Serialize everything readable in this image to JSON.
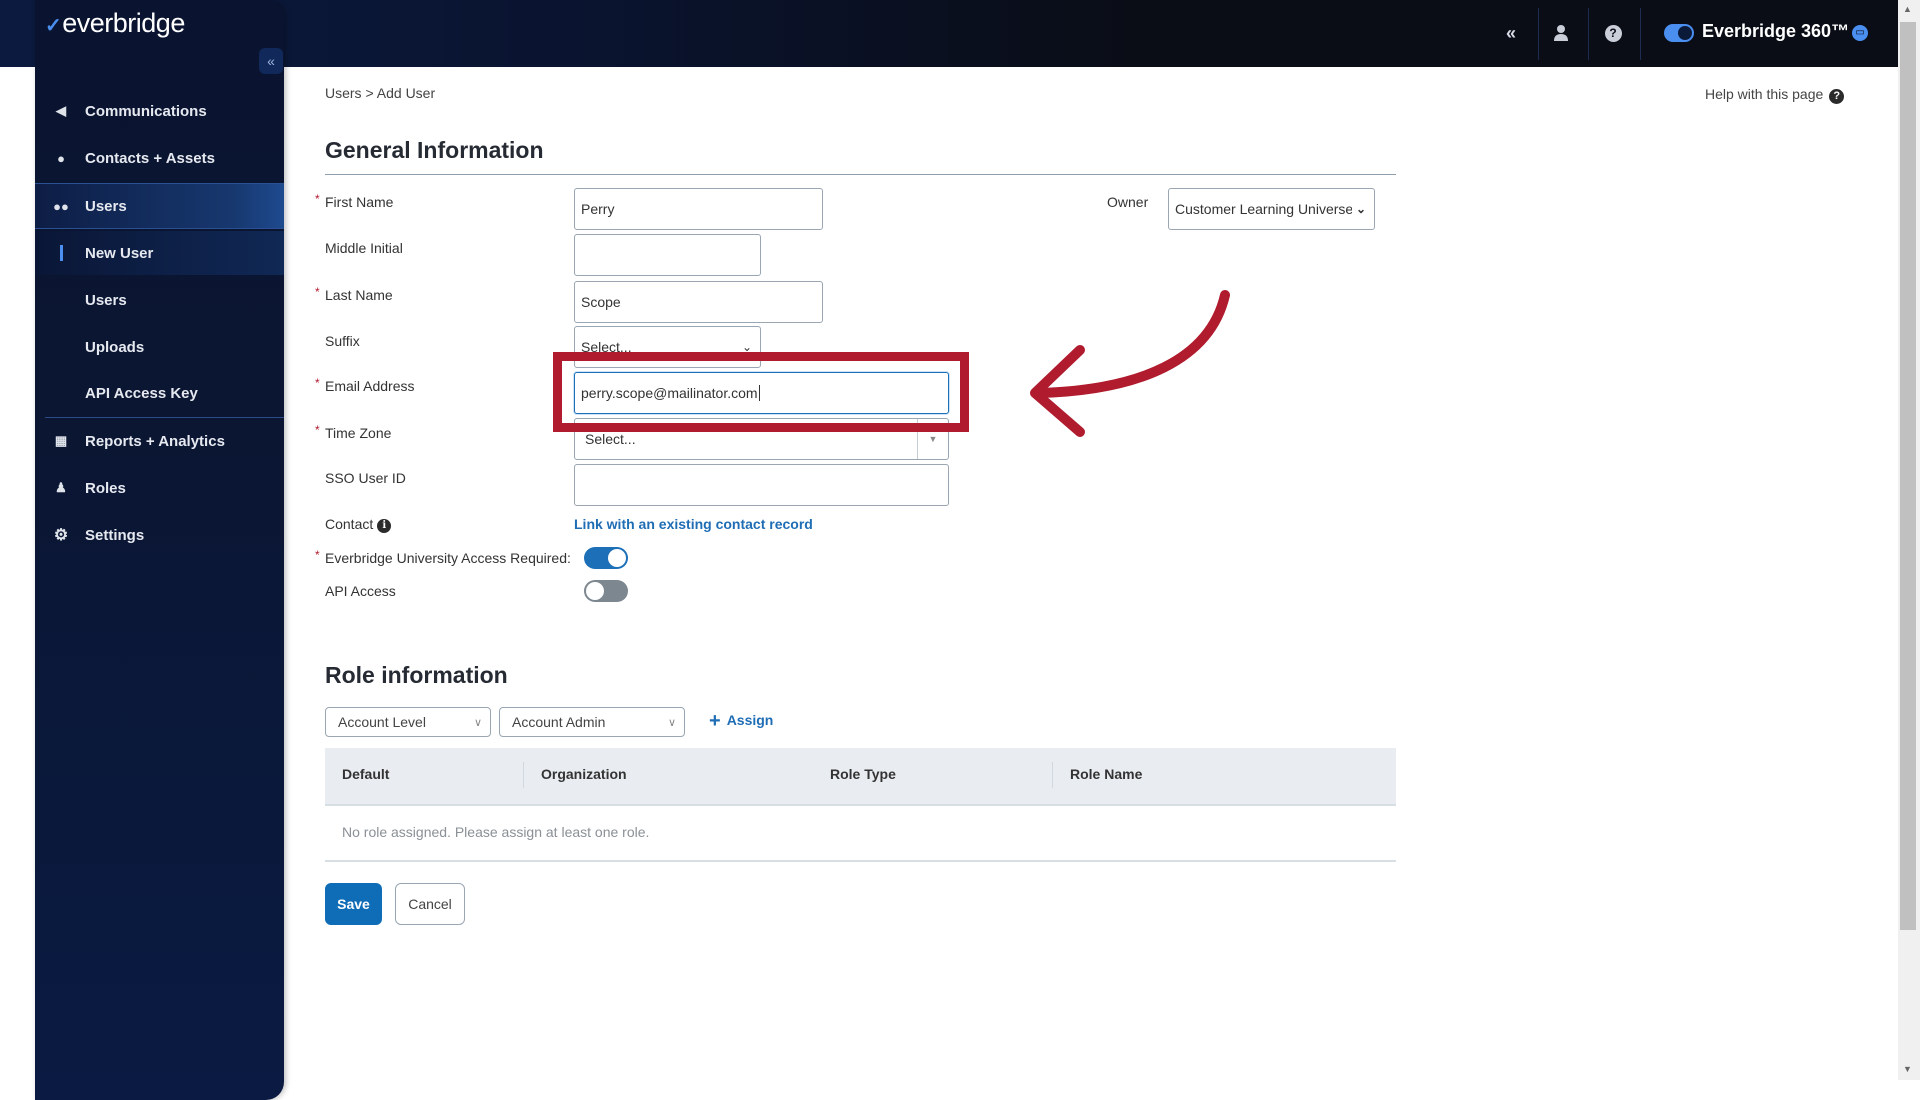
{
  "header": {
    "collapse_icon": "double-chevron-left-icon",
    "collapse_glyph": "«",
    "profile_icon": "user-icon",
    "help_icon": "question-circle-icon",
    "product_label": "Everbridge 360™",
    "product_toggle_on": true,
    "chat_icon": "chat-bubble-icon"
  },
  "sidebar": {
    "logo_text": "everbridge",
    "collapse_glyph": "«",
    "items": [
      {
        "label": "Communications",
        "icon": "megaphone-icon",
        "glyph": "📢"
      },
      {
        "label": "Contacts + Assets",
        "icon": "map-pin-icon",
        "glyph": "⚲"
      },
      {
        "label": "Users",
        "icon": "users-icon",
        "glyph": "👥"
      },
      {
        "label": "Reports + Analytics",
        "icon": "bar-chart-icon",
        "glyph": "▦"
      },
      {
        "label": "Roles",
        "icon": "user-gear-icon",
        "glyph": "👤"
      },
      {
        "label": "Settings",
        "icon": "gear-icon",
        "glyph": "⚙"
      }
    ],
    "users_subitems": [
      {
        "label": "New User",
        "current": true
      },
      {
        "label": "Users"
      },
      {
        "label": "Uploads"
      },
      {
        "label": "API Access Key"
      }
    ]
  },
  "breadcrumb": {
    "parent": "Users",
    "separator": ">",
    "current": "Add User"
  },
  "help": {
    "label": "Help with this page"
  },
  "general": {
    "title": "General Information",
    "required_mark": "*",
    "first_name": {
      "label": "First Name",
      "value": "Perry"
    },
    "middle_initial": {
      "label": "Middle Initial",
      "value": ""
    },
    "last_name": {
      "label": "Last Name",
      "value": "Scope"
    },
    "suffix": {
      "label": "Suffix",
      "value": "Select..."
    },
    "email": {
      "label": "Email Address",
      "value": "perry.scope@mailinator.com"
    },
    "time_zone": {
      "label": "Time Zone",
      "value": "Select..."
    },
    "sso_user_id": {
      "label": "SSO User ID",
      "value": ""
    },
    "contact": {
      "label": "Contact",
      "link": "Link with an existing contact record"
    },
    "university_access": {
      "label": "Everbridge University Access Required:",
      "on": true
    },
    "api_access": {
      "label": "API Access",
      "on": false
    },
    "owner": {
      "label": "Owner",
      "value": "Customer Learning Universe"
    }
  },
  "roles": {
    "title": "Role information",
    "level_select": "Account Level",
    "role_select": "Account Admin",
    "assign_label": "Assign",
    "columns": [
      "Default",
      "Organization",
      "Role Type",
      "Role Name"
    ],
    "empty_message": "No role assigned. Please assign at least one role."
  },
  "actions": {
    "save": "Save",
    "cancel": "Cancel"
  },
  "annotation": {
    "color": "#b01b2e",
    "target": "Email Address field"
  }
}
